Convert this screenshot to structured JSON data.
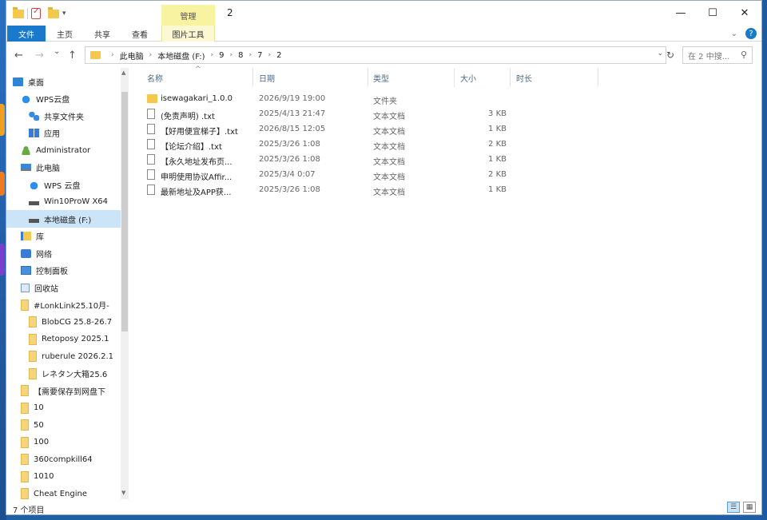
{
  "window": {
    "title": "2",
    "context_tab_header": "管理",
    "minimize": "—",
    "maximize": "☐",
    "close": "✕"
  },
  "ribbon": {
    "tabs": [
      "文件",
      "主页",
      "共享",
      "查看",
      "图片工具"
    ],
    "help": "?"
  },
  "address": {
    "back": "←",
    "forward": "→",
    "recent": "⌄",
    "up": "↑",
    "breadcrumbs": [
      "此电脑",
      "本地磁盘 (F:)",
      "9",
      "8",
      "7",
      "2"
    ],
    "search_placeholder": "在 2 中搜..."
  },
  "sidebar": {
    "items": [
      {
        "label": "桌面",
        "icon": "desktop-icon"
      },
      {
        "label": "WPS云盘",
        "icon": "cloud-icon"
      },
      {
        "label": "共享文件夹",
        "icon": "share-icon"
      },
      {
        "label": "应用",
        "icon": "apps-icon"
      },
      {
        "label": "Administrator",
        "icon": "user-icon"
      },
      {
        "label": "此电脑",
        "icon": "pc-icon"
      },
      {
        "label": "WPS 云盘",
        "icon": "cloud-icon"
      },
      {
        "label": "Win10ProW X64",
        "icon": "drive-icon"
      },
      {
        "label": "本地磁盘 (F:)",
        "icon": "drive-icon"
      },
      {
        "label": "库",
        "icon": "library-icon"
      },
      {
        "label": "网络",
        "icon": "network-icon"
      },
      {
        "label": "控制面板",
        "icon": "control-panel-icon"
      },
      {
        "label": "回收站",
        "icon": "recycle-bin-icon"
      },
      {
        "label": "#LonkLink25.10月-",
        "icon": "folder-icon"
      },
      {
        "label": "BlobCG 25.8-26.7",
        "icon": "folder-icon"
      },
      {
        "label": "Retoposy 2025.1",
        "icon": "folder-icon"
      },
      {
        "label": "ruberule 2026.2.1",
        "icon": "folder-icon"
      },
      {
        "label": "レネタン大箱25.6",
        "icon": "folder-icon"
      },
      {
        "label": "【需要保存到网盘下",
        "icon": "folder-icon"
      },
      {
        "label": "10",
        "icon": "folder-icon"
      },
      {
        "label": "50",
        "icon": "folder-icon"
      },
      {
        "label": "100",
        "icon": "folder-icon"
      },
      {
        "label": "360compkill64",
        "icon": "folder-icon"
      },
      {
        "label": "1010",
        "icon": "folder-icon"
      },
      {
        "label": "Cheat Engine",
        "icon": "folder-icon"
      }
    ]
  },
  "columns": [
    "名称",
    "日期",
    "类型",
    "大小",
    "时长"
  ],
  "files": [
    {
      "name": "isewagakari_1.0.0",
      "date": "2026/9/19 19:00",
      "type": "文件夹",
      "size": "",
      "icon": "folder"
    },
    {
      "name": "(免责声明) .txt",
      "date": "2025/4/13 21:47",
      "type": "文本文档",
      "size": "3 KB",
      "icon": "txt"
    },
    {
      "name": "【好用便宜梯子】.txt",
      "date": "2026/8/15 12:05",
      "type": "文本文档",
      "size": "1 KB",
      "icon": "txt"
    },
    {
      "name": "【论坛介绍】.txt",
      "date": "2025/3/26 1:08",
      "type": "文本文档",
      "size": "2 KB",
      "icon": "txt"
    },
    {
      "name": "【永久地址发布页...",
      "date": "2025/3/26 1:08",
      "type": "文本文档",
      "size": "1 KB",
      "icon": "txt"
    },
    {
      "name": "申明使用协议Affir...",
      "date": "2025/3/4 0:07",
      "type": "文本文档",
      "size": "2 KB",
      "icon": "txt"
    },
    {
      "name": "最新地址及APP获...",
      "date": "2025/3/26 1:08",
      "type": "文本文档",
      "size": "1 KB",
      "icon": "txt"
    }
  ],
  "status": {
    "item_count": "7 个项目"
  },
  "colors": {
    "accent": "#1979ca",
    "selection": "#cce4f7",
    "context_tab": "#f7f3a1",
    "folder": "#f2c94c"
  }
}
